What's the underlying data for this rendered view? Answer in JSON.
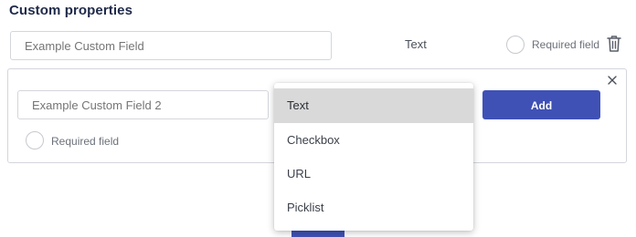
{
  "section_title": "Custom properties",
  "existing_field": {
    "placeholder": "Example Custom Field",
    "type_label": "Text",
    "required_label": "Required field",
    "icons": {
      "delete": "trash-icon"
    }
  },
  "new_field": {
    "placeholder": "Example Custom Field 2",
    "required_label": "Required field",
    "add_label": "Add",
    "icons": {
      "close": "close-icon"
    }
  },
  "type_dropdown": {
    "selected": "Text",
    "options": [
      "Text",
      "Checkbox",
      "URL",
      "Picklist"
    ]
  },
  "colors": {
    "accent": "#3f51b5",
    "selected_option_bg": "#d9d9d9",
    "title": "#1f2a4a"
  }
}
